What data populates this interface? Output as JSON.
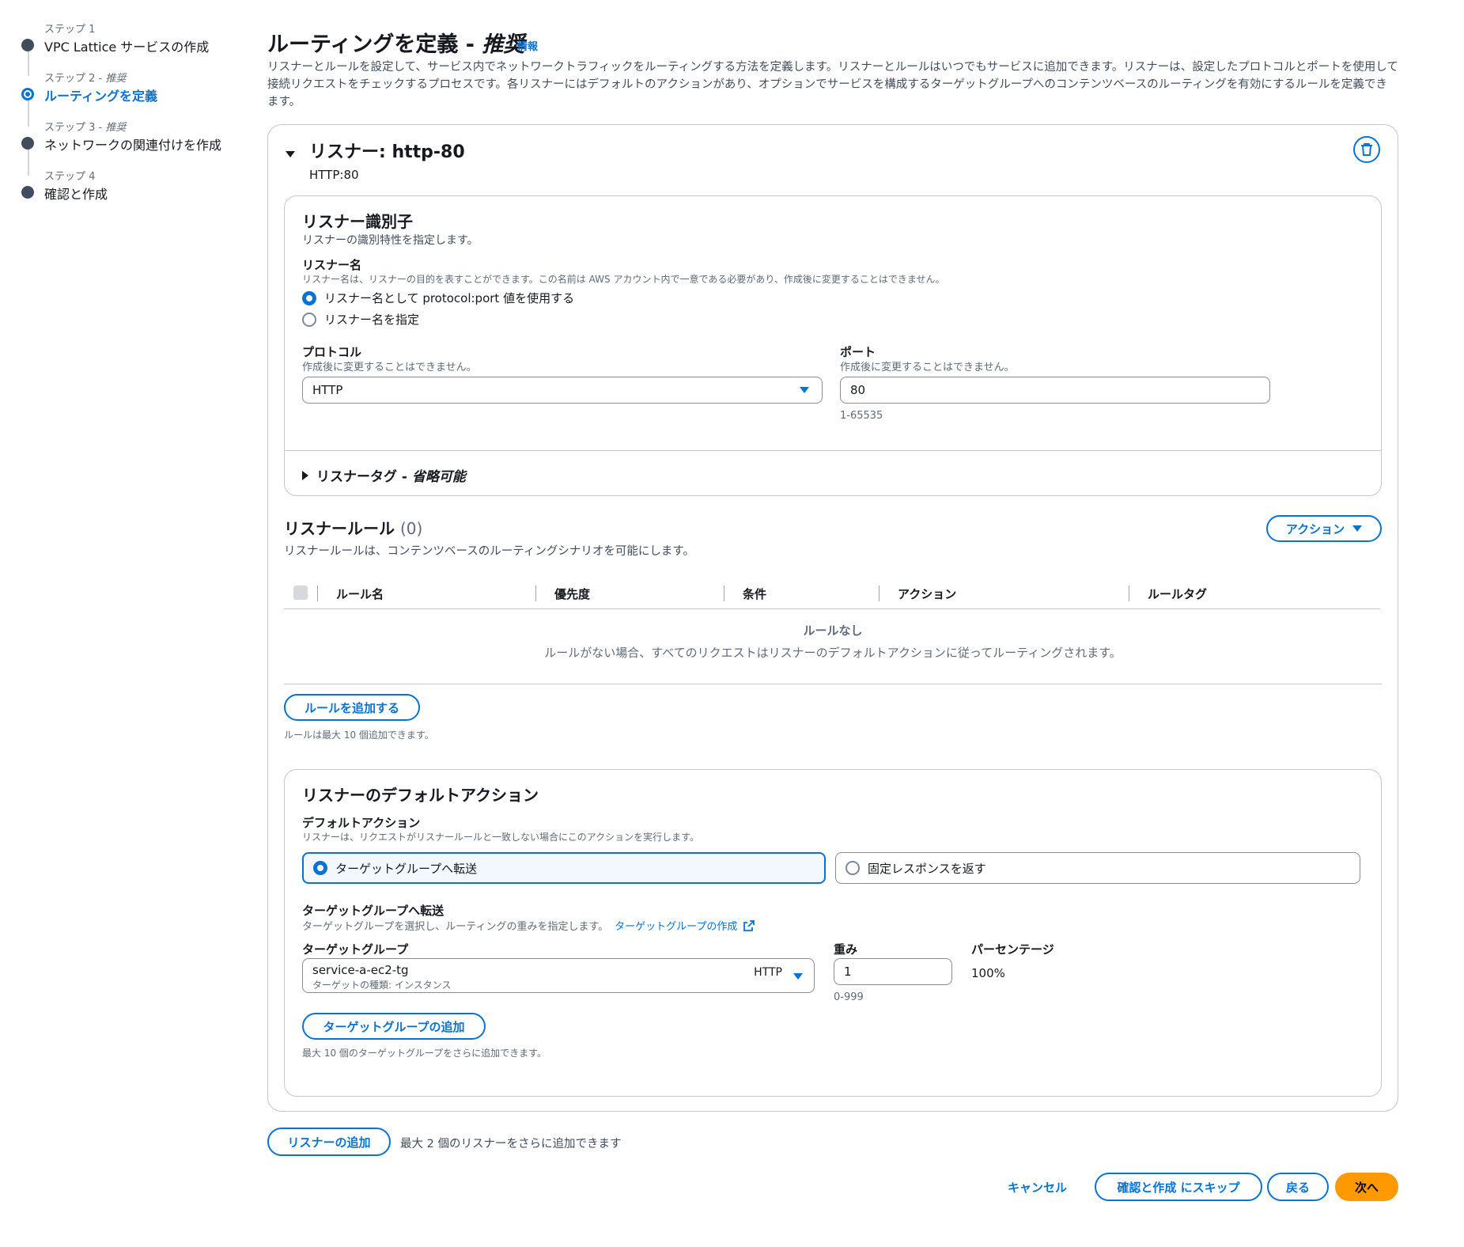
{
  "steps": [
    {
      "caption": "ステップ 1",
      "title": "VPC Lattice サービスの作成"
    },
    {
      "caption": "ステップ 2 - ",
      "caption_em": "推奨",
      "title": "ルーティングを定義"
    },
    {
      "caption": "ステップ 3 - ",
      "caption_em": "推奨",
      "title": "ネットワークの関連付けを作成"
    },
    {
      "caption": "ステップ 4",
      "title": "確認と作成"
    }
  ],
  "header": {
    "title": "ルーティングを定義 - ",
    "title_em": "推奨",
    "info": "情報",
    "description": "リスナーとルールを設定して、サービス内でネットワークトラフィックをルーティングする方法を定義します。リスナーとルールはいつでもサービスに追加できます。リスナーは、設定したプロトコルとポートを使用して接続リクエストをチェックするプロセスです。各リスナーにはデフォルトのアクションがあり、オプションでサービスを構成するターゲットグループへのコンテンツベースのルーティングを有効にするルールを定義できます。"
  },
  "listener": {
    "title": "リスナー: http-80",
    "subtitle": "HTTP:80",
    "identifier": {
      "heading": "リスナー識別子",
      "description": "リスナーの識別特性を指定します。",
      "name_label": "リスナー名",
      "name_hint": "リスナー名は、リスナーの目的を表すことができます。この名前は AWS アカウント内で一意である必要があり、作成後に変更することはできません。",
      "option_default": "リスナー名として protocol:port 値を使用する",
      "option_custom": "リスナー名を指定",
      "protocol_label": "プロトコル",
      "protocol_hint": "作成後に変更することはできません。",
      "protocol_value": "HTTP",
      "port_label": "ポート",
      "port_hint": "作成後に変更することはできません。",
      "port_value": "80",
      "port_range": "1-65535",
      "tags_label": "リスナータグ - ",
      "tags_em": "省略可能"
    },
    "rules": {
      "heading": "リスナールール",
      "count": "(0)",
      "description": "リスナールールは、コンテンツベースのルーティングシナリオを可能にします。",
      "actions_button": "アクション",
      "columns": [
        "ルール名",
        "優先度",
        "条件",
        "アクション",
        "ルールタグ"
      ],
      "empty_title": "ルールなし",
      "empty_desc": "ルールがない場合、すべてのリクエストはリスナーのデフォルトアクションに従ってルーティングされます。",
      "add_button": "ルールを追加する",
      "add_hint": "ルールは最大 10 個追加できます。"
    },
    "default_action": {
      "heading": "リスナーのデフォルトアクション",
      "label": "デフォルトアクション",
      "hint": "リスナーは、リクエストがリスナールールと一致しない場合にこのアクションを実行します。",
      "option_forward": "ターゲットグループへ転送",
      "option_fixed": "固定レスポンスを返す",
      "forward_label": "ターゲットグループへ転送",
      "forward_hint": "ターゲットグループを選択し、ルーティングの重みを指定します。",
      "create_link": "ターゲットグループの作成",
      "tg_label": "ターゲットグループ",
      "tg_value": "service-a-ec2-tg",
      "tg_sub": "ターゲットの種類: インスタンス",
      "tg_protocol": "HTTP",
      "weight_label": "重み",
      "weight_value": "1",
      "weight_range": "0-999",
      "percent_label": "パーセンテージ",
      "percent_value": "100%",
      "add_tg_button": "ターゲットグループの追加",
      "add_tg_hint": "最大 10 個のターゲットグループをさらに追加できます。"
    }
  },
  "footer": {
    "add_listener": "リスナーの追加",
    "add_listener_hint": "最大 2 個のリスナーをさらに追加できます",
    "cancel": "キャンセル",
    "skip": "確認と作成 にスキップ",
    "back": "戻る",
    "next": "次へ"
  },
  "colors": {
    "accent": "#0972d3",
    "primary": "#ff9900"
  }
}
